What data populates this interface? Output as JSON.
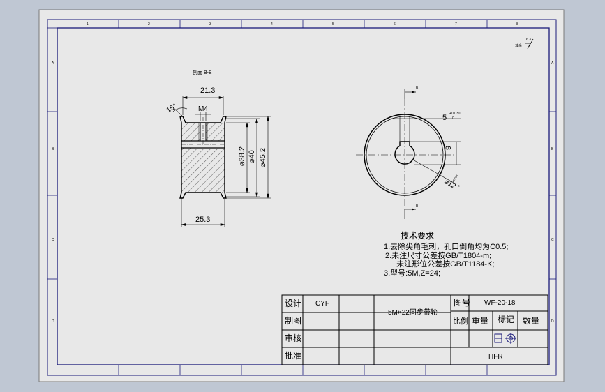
{
  "window": {
    "background": "#bfc7d3",
    "sheet": "#e8e8e8",
    "border_color": "#1a1a7a"
  },
  "sheet": {
    "zone_letters_left": [
      "A",
      "B",
      "C",
      "D"
    ],
    "zone_digits_top": [
      "1",
      "2",
      "3",
      "4",
      "5",
      "6",
      "7",
      "8"
    ]
  },
  "section_label": "剖面 B-B",
  "surface_finish": {
    "prefix": "其余",
    "value": "6.3"
  },
  "dimensions": {
    "width_top": "21.3",
    "thread": "M4",
    "angle": "15°",
    "dia_inner": "⌀38.2",
    "dia_hub": "⌀40",
    "dia_outer": "⌀45.2",
    "width_bottom": "25.3",
    "key_width": "5",
    "key_tol_upper": "+0.030",
    "key_tol_lower": "0",
    "key_depth": "9",
    "bore": "⌀12",
    "bore_tol_upper": "+0.018",
    "bore_tol_lower": "0",
    "section_mark": "B"
  },
  "tech_requirements": {
    "title": "技术要求",
    "lines": [
      "1.去除尖角毛刺，孔口倒角均为C0.5;",
      "2.未注尺寸公差按GB/T1804-m;",
      "  未注形位公差按GB/T1184-K;",
      "3.型号:5M,Z=24;"
    ]
  },
  "title_block": {
    "designer_label": "设计",
    "designer": "CYF",
    "draft_label": "制图",
    "review_label": "审核",
    "approve_label": "批准",
    "part_name": "5M×22同步带轮",
    "drawing_no_label": "图号",
    "drawing_no": "WF-20-18",
    "scale_label": "比例",
    "weight_label": "重量",
    "mark_label": "标记",
    "qty_label": "数量",
    "material": "HFR"
  }
}
